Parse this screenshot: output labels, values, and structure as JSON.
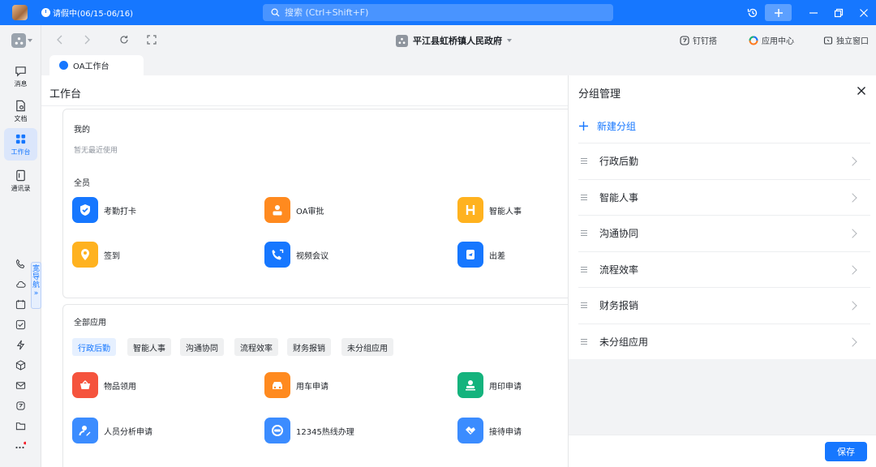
{
  "titlebar": {
    "status_text": "请假中(06/15-06/16)",
    "search_placeholder": "搜索 (Ctrl+Shift+F)"
  },
  "toolbar": {
    "org_name": "平江县虹桥镇人民政府",
    "dingda": "钉钉搭",
    "app_center": "应用中心",
    "standalone": "独立窗口"
  },
  "sidebar": {
    "items": [
      {
        "label": "消息",
        "icon": "message-icon"
      },
      {
        "label": "文档",
        "icon": "document-icon"
      },
      {
        "label": "工作台",
        "icon": "workbench-icon"
      },
      {
        "label": "通讯录",
        "icon": "contacts-icon"
      }
    ],
    "wide_nav": "宽导航",
    "wide_nav_arrow": "»"
  },
  "tab": {
    "label": "OA工作台"
  },
  "main": {
    "title": "工作台",
    "mine": {
      "title": "我的",
      "empty": "暂无最近使用"
    },
    "all_members": {
      "title": "全员",
      "apps": [
        {
          "label": "考勤打卡",
          "color": "#1677ff",
          "icon": "shield-check-icon"
        },
        {
          "label": "OA审批",
          "color": "#ff8a1f",
          "icon": "person-card-icon"
        },
        {
          "label": "智能人事",
          "color": "#ffb21f",
          "icon": "hr-icon"
        },
        {
          "label": "签到",
          "color": "#ffb21f",
          "icon": "location-pin-icon"
        },
        {
          "label": "视频会议",
          "color": "#1677ff",
          "icon": "video-call-icon"
        },
        {
          "label": "出差",
          "color": "#1677ff",
          "icon": "airplane-icon"
        }
      ]
    },
    "all_apps": {
      "title": "全部应用",
      "chips": [
        "行政后勤",
        "智能人事",
        "沟通协同",
        "流程效率",
        "财务报销",
        "未分组应用"
      ],
      "apps": [
        {
          "label": "物品领用",
          "color": "#f5533d",
          "icon": "basket-icon"
        },
        {
          "label": "用车申请",
          "color": "#ff8a1f",
          "icon": "car-icon"
        },
        {
          "label": "用印申请",
          "color": "#14b37d",
          "icon": "stamp-icon"
        },
        {
          "label": "人员分析申请",
          "color": "#3b8cff",
          "icon": "user-edit-icon"
        },
        {
          "label": "12345热线办理",
          "color": "#3b8cff",
          "icon": "hotline-icon"
        },
        {
          "label": "接待申请",
          "color": "#3b8cff",
          "icon": "handshake-icon"
        }
      ]
    }
  },
  "panel": {
    "title": "分组管理",
    "new_group": "新建分组",
    "groups": [
      "行政后勤",
      "智能人事",
      "沟通协同",
      "流程效率",
      "财务报销",
      "未分组应用"
    ],
    "save_label": "保存"
  }
}
